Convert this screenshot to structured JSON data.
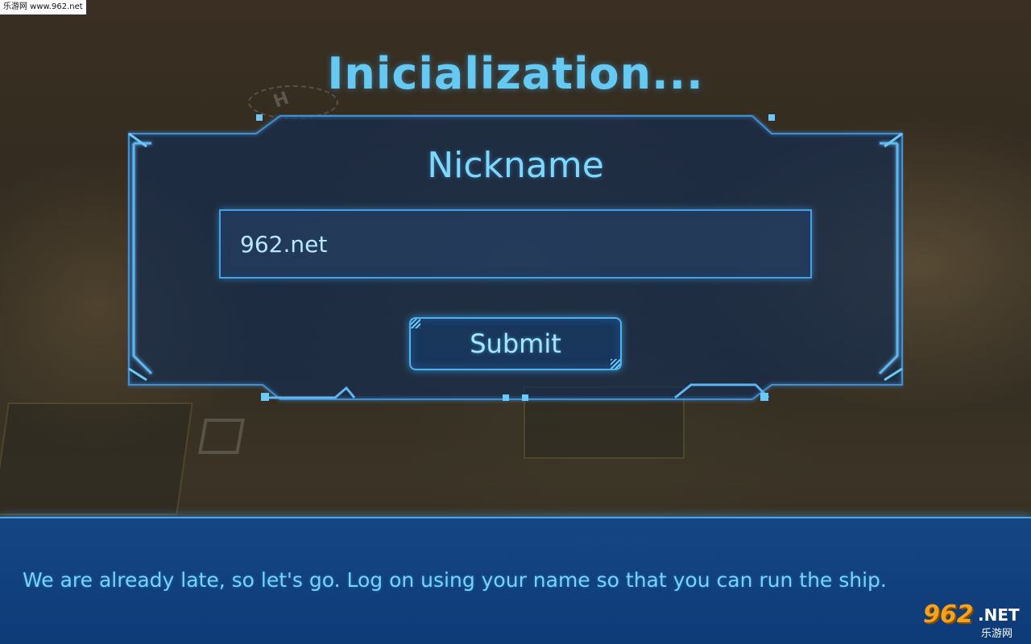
{
  "watermark": {
    "top_text": "乐游网 www.962.net",
    "logo_number": "962",
    "logo_suffix": ".NET",
    "logo_subtitle": "乐游网"
  },
  "screen": {
    "title": "Inicialization..."
  },
  "form": {
    "label": "Nickname",
    "nickname_value": "962.net",
    "submit_label": "Submit"
  },
  "dialog": {
    "text": "We are already late, so let's go. Log on using your name so that you can run the ship."
  },
  "colors": {
    "accent": "#66c9f2",
    "frame": "#4a9fe0",
    "dialog_bg": "#12488c"
  }
}
